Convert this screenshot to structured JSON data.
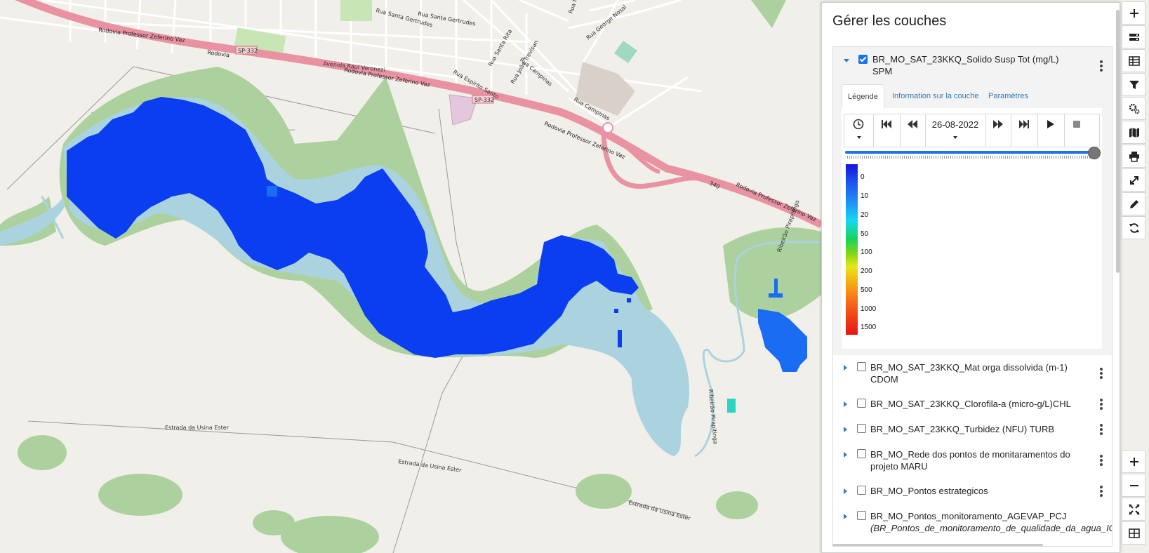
{
  "map": {
    "street_labels": [
      "Rodovia Professor Zeferino Vaz",
      "Rodovia",
      "SP-332",
      "Avenida Raul Veronezi",
      "Rodovia Professor Zeferino Vaz",
      "SP-332",
      "Rodovia Professor Zeferino Vaz",
      "Rua Campinas",
      "Rua Campinas",
      "Rua George Nosal",
      "Rua Santa Gertrudes",
      "Rua Espírito Santo",
      "Rua Santa Rita",
      "Rua João Trevisan",
      "Estrada da Usina Ester",
      "Estrada da Usina Ester",
      "Estrada da Usina Ester",
      "Ribeirão Pirapitinga",
      "Ribeirão Pirapitinga",
      "Rodovia Professor Zeferino Vaz",
      "340",
      "Rua Marc",
      "Rua Santa Gertrudes"
    ],
    "colors": {
      "water": "#aad3df",
      "green": "#add19e",
      "highway": "#e892a2",
      "spm_low": "#0a3ef0",
      "spm_mid": "#1a6cf2"
    }
  },
  "panel": {
    "title": "Gérer les couches",
    "active_layer": {
      "name_line1": "BR_MO_SAT_23KKQ_Solido Susp Tot (mg/L)",
      "name_line2": "SPM",
      "checked": true,
      "tabs": [
        {
          "label": "Légende",
          "active": true
        },
        {
          "label": "Information sur la couche",
          "active": false
        },
        {
          "label": "Paramètres",
          "active": false
        }
      ],
      "time_control": {
        "date": "26-08-2022",
        "buttons": [
          "clock-icon",
          "skip-back-icon",
          "step-back-icon",
          "date-select",
          "step-forward-icon",
          "skip-forward-icon",
          "play-icon",
          "stop-icon"
        ],
        "position": 1.0
      },
      "legend": {
        "labels": [
          "0",
          "10",
          "20",
          "50",
          "100",
          "200",
          "500",
          "1000",
          "1500"
        ]
      }
    },
    "layers": [
      {
        "line1": "BR_MO_SAT_23KKQ_Mat orga dissolvida (m-1)",
        "line2": "CDOM",
        "checked": false
      },
      {
        "line1": "BR_MO_SAT_23KKQ_Clorofila-a (micro-g/L)CHL",
        "line2": "",
        "checked": false
      },
      {
        "line1": "BR_MO_SAT_23KKQ_Turbidez (NFU) TURB",
        "line2": "",
        "checked": false
      },
      {
        "line1": "BR_MO_Rede dos pontos de monitaramentos do",
        "line2": "projeto MARU",
        "checked": false
      },
      {
        "line1": "BR_MO_Pontos estrategicos",
        "line2": "",
        "checked": false
      },
      {
        "line1": "BR_MO_Pontos_monitoramento_AGEVAP_PCJ",
        "line2": "(BR_Pontos_de_monitoramento_de_qualidade_da_agua_IGAM",
        "checked": false
      }
    ]
  },
  "toolbar": {
    "top": [
      "plus-icon",
      "layers-stack-icon",
      "table-icon",
      "filter-icon",
      "gears-icon",
      "map-icon",
      "print-icon",
      "expand-icon",
      "pencil-icon",
      "refresh-icon"
    ],
    "bottom": [
      "zoom-in-icon",
      "zoom-out-icon",
      "fullscreen-icon",
      "grid-icon"
    ]
  }
}
